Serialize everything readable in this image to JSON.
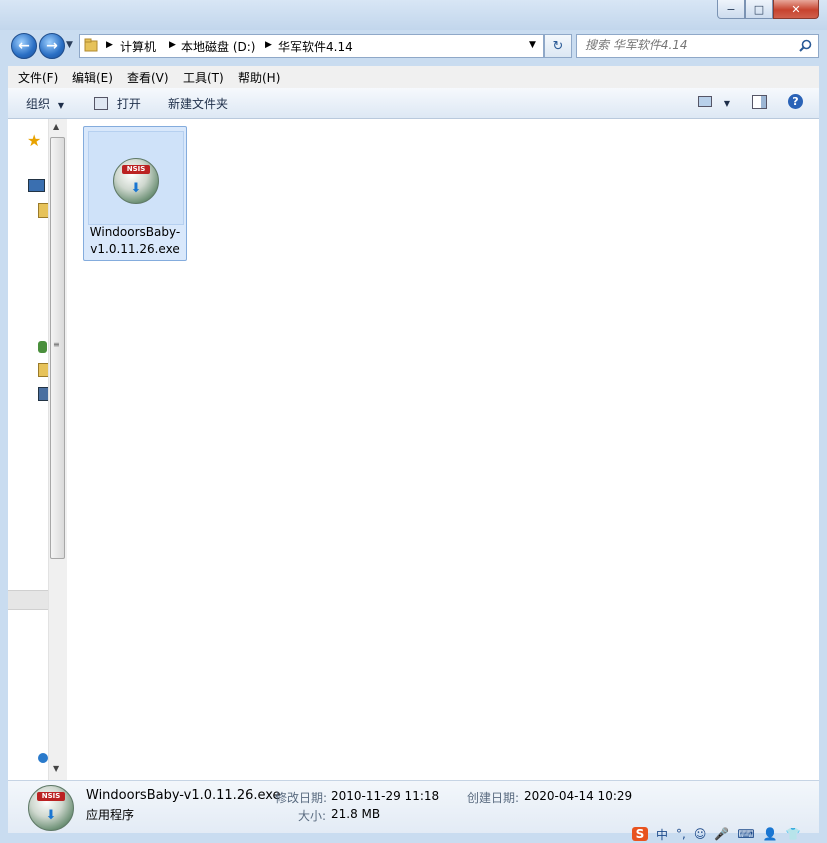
{
  "window": {
    "minimize": "−",
    "maximize": "□",
    "close": "✕"
  },
  "address": {
    "segments": [
      "计算机",
      "本地磁盘 (D:)",
      "华军软件4.14"
    ],
    "search_placeholder": "搜索 华军软件4.14"
  },
  "menu": [
    "文件(F)",
    "编辑(E)",
    "查看(V)",
    "工具(T)",
    "帮助(H)"
  ],
  "commands": {
    "organize": "组织",
    "open": "打开",
    "new_folder": "新建文件夹"
  },
  "file": {
    "name": "WindoorsBaby-v1.0.11.26.exe",
    "name_line1": "WindoorsBaby-",
    "name_line2": "v1.0.11.26.exe",
    "icon_label": "NSIS"
  },
  "details": {
    "name": "WindoorsBaby-v1.0.11.26.exe",
    "type": "应用程序",
    "modified_label": "修改日期:",
    "modified": "2010-11-29 11:18",
    "size_label": "大小:",
    "size": "21.8 MB",
    "created_label": "创建日期:",
    "created": "2020-04-14 10:29"
  },
  "tray": [
    "中",
    "°,",
    "☺",
    "🎤",
    "⌨",
    "👤",
    "👕"
  ]
}
